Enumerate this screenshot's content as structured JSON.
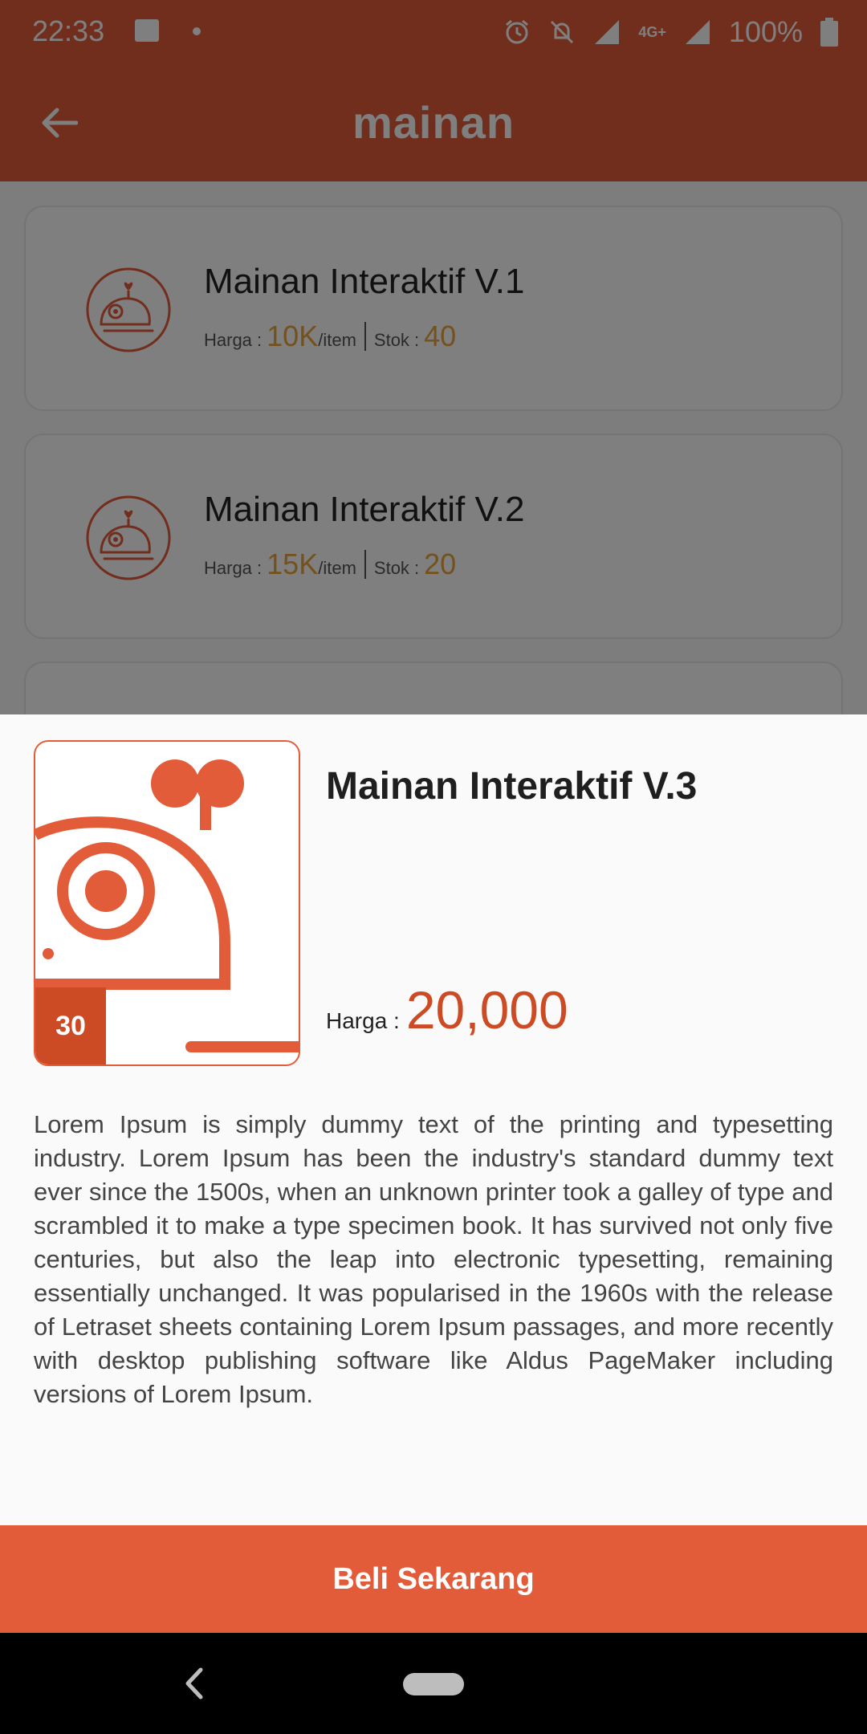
{
  "status_bar": {
    "time": "22:33",
    "battery": "100%",
    "network": "4G+"
  },
  "app_bar": {
    "title": "mainan"
  },
  "products": [
    {
      "name": "Mainan Interaktif V.1",
      "price_label": "Harga :",
      "price": "10K",
      "unit": "/item",
      "stock_label": "Stok :",
      "stock": "40"
    },
    {
      "name": "Mainan Interaktif V.2",
      "price_label": "Harga :",
      "price": "15K",
      "unit": "/item",
      "stock_label": "Stok :",
      "stock": "20"
    }
  ],
  "detail": {
    "name": "Mainan Interaktif V.3",
    "stock": "30",
    "price_label": "Harga :",
    "price": "20,000",
    "description": "Lorem Ipsum is simply dummy text of the printing and typesetting industry. Lorem Ipsum has been the industry's standard dummy text ever since the 1500s, when an unknown printer took a galley of type and scrambled it to make a type specimen book. It has survived not only five centuries, but also the leap into electronic typesetting, remaining essentially unchanged. It was popularised in the 1960s with the release of Letraset sheets containing Lorem Ipsum passages, and more recently with desktop publishing software like Aldus PageMaker including versions of Lorem Ipsum."
  },
  "buy_button": {
    "label": "Beli Sekarang"
  },
  "icons": {
    "product": "wind-up-mouse-icon",
    "back": "arrow-left-icon"
  },
  "colors": {
    "primary": "#e35c3a",
    "price_accent": "#cc4a24",
    "stock_accent": "#e8a33a"
  }
}
